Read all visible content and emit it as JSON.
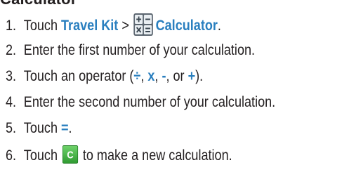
{
  "heading": "Calculator",
  "steps": [
    {
      "number": "1.",
      "prefix": "Touch ",
      "link1": "Travel Kit",
      "separator": " > ",
      "link2": "Calculator",
      "suffix": "."
    },
    {
      "number": "2.",
      "text": "Enter the first number of your calculation."
    },
    {
      "number": "3.",
      "prefix": "Touch an operator (",
      "ops": [
        "÷",
        "x",
        "-",
        "+"
      ],
      "sep1": ", ",
      "sep2": ", ",
      "sep3": ", or ",
      "suffix": ")."
    },
    {
      "number": "4.",
      "text": "Enter the second number of your calculation."
    },
    {
      "number": "5.",
      "prefix": "Touch ",
      "key": "=",
      "suffix": "."
    },
    {
      "number": "6.",
      "prefix": "Touch ",
      "button": "C",
      "suffix": " to make a new calculation."
    }
  ],
  "colors": {
    "keyword": "#2a7fbf",
    "text": "#231f20",
    "clear_button": "#3aa63a"
  },
  "icons": [
    "calculator-icon",
    "clear-button-icon"
  ]
}
